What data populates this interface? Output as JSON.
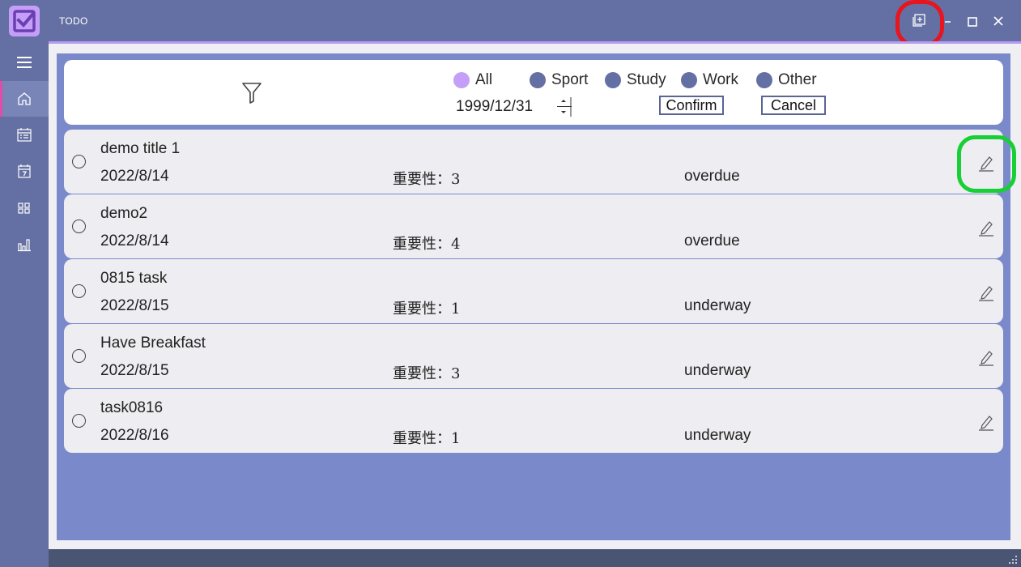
{
  "app": {
    "title": "TODO"
  },
  "titlebar": {
    "icons": [
      "todo-logo-icon",
      "add-window-icon",
      "minimize-icon",
      "maximize-icon",
      "close-icon"
    ]
  },
  "sidebar": {
    "items": [
      {
        "icon": "menu-icon",
        "active": false
      },
      {
        "icon": "home-icon",
        "active": true
      },
      {
        "icon": "calendar-list-icon",
        "active": false
      },
      {
        "icon": "calendar-day-icon",
        "active": false
      },
      {
        "icon": "grid-icon",
        "active": false
      },
      {
        "icon": "bar-chart-icon",
        "active": false
      }
    ]
  },
  "filter": {
    "icon": "filter-icon",
    "categories": [
      {
        "label": "All",
        "selected": true
      },
      {
        "label": "Sport",
        "selected": false
      },
      {
        "label": "Study",
        "selected": false
      },
      {
        "label": "Work",
        "selected": false
      },
      {
        "label": "Other",
        "selected": false
      }
    ],
    "date": "1999/12/31",
    "confirm_label": "Confirm",
    "cancel_label": "Cancel"
  },
  "tasks": [
    {
      "title": "demo title 1",
      "date": "2022/8/14",
      "importance": "重要性：3",
      "status": "overdue"
    },
    {
      "title": "demo2",
      "date": "2022/8/14",
      "importance": "重要性：4",
      "status": "overdue"
    },
    {
      "title": "0815 task",
      "date": "2022/8/15",
      "importance": "重要性：1",
      "status": "underway"
    },
    {
      "title": "Have Breakfast",
      "date": "2022/8/15",
      "importance": "重要性：3",
      "status": "underway"
    },
    {
      "title": "task0816",
      "date": "2022/8/16",
      "importance": "重要性：1",
      "status": "underway"
    }
  ],
  "colors": {
    "sidebar": "#6470a3",
    "content": "#7a89c9",
    "accent": "#c59ff7",
    "active_marker": "#e04da8",
    "highlight_red": "#e8141e",
    "highlight_green": "#18cf35"
  }
}
